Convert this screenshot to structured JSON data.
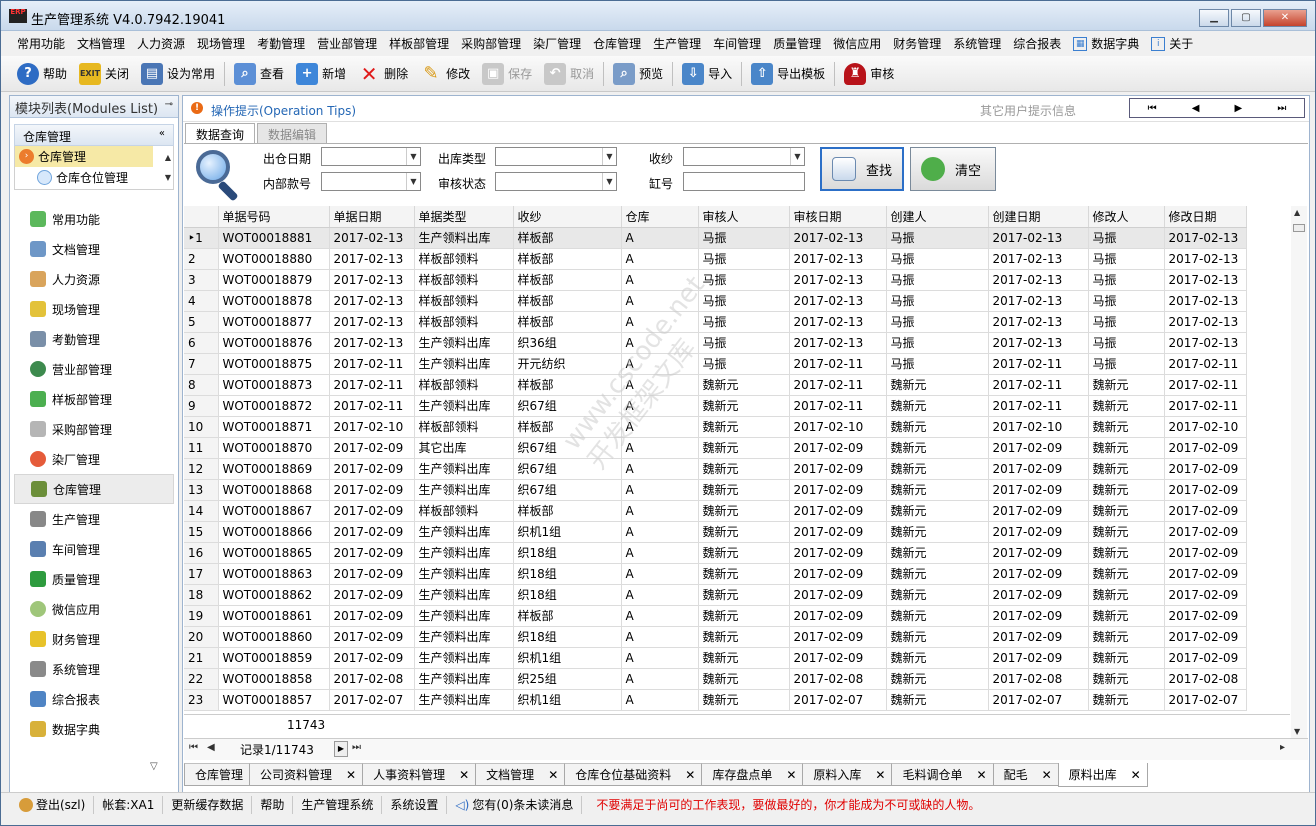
{
  "window": {
    "title": "生产管理系统 V4.0.7942.19041",
    "logo": "ERP"
  },
  "menus": [
    "常用功能",
    "文档管理",
    "人力资源",
    "现场管理",
    "考勤管理",
    "营业部管理",
    "样板部管理",
    "采购部管理",
    "染厂管理",
    "仓库管理",
    "生产管理",
    "车间管理",
    "质量管理",
    "微信应用",
    "财务管理",
    "系统管理",
    "综合报表",
    "数据字典",
    "关于"
  ],
  "toolbar": {
    "help": "帮助",
    "close": "关闭",
    "set_favorite": "设为常用",
    "view": "查看",
    "add": "新增",
    "delete": "删除",
    "edit": "修改",
    "save": "保存",
    "cancel": "取消",
    "preview": "预览",
    "import": "导入",
    "export_template": "导出模板",
    "audit": "审核"
  },
  "sidebar": {
    "header": "模块列表(Modules List)",
    "group": "仓库管理",
    "tree": [
      "仓库管理",
      "仓库仓位管理"
    ],
    "modules": [
      "常用功能",
      "文档管理",
      "人力资源",
      "现场管理",
      "考勤管理",
      "营业部管理",
      "样板部管理",
      "采购部管理",
      "染厂管理",
      "仓库管理",
      "生产管理",
      "车间管理",
      "质量管理",
      "微信应用",
      "财务管理",
      "系统管理",
      "综合报表",
      "数据字典"
    ]
  },
  "tips": {
    "text": "操作提示(Operation Tips)",
    "other": "其它用户提示信息"
  },
  "subtabs": [
    "数据查询",
    "数据编辑"
  ],
  "query": {
    "out_date": "出仓日期",
    "internal_no": "内部款号",
    "out_type": "出库类型",
    "audit_status": "审核状态",
    "receiver": "收纱",
    "vat_no": "缸号",
    "search": "查找",
    "clear": "清空"
  },
  "grid": {
    "columns": [
      "",
      "单据号码",
      "单据日期",
      "单据类型",
      "收纱",
      "仓库",
      "审核人",
      "审核日期",
      "创建人",
      "创建日期",
      "修改人",
      "修改日期"
    ],
    "rows": [
      [
        "1",
        "WOT00018881",
        "2017-02-13",
        "生产领料出库",
        "样板部",
        "A",
        "马振",
        "2017-02-13",
        "马振",
        "2017-02-13",
        "马振",
        "2017-02-13"
      ],
      [
        "2",
        "WOT00018880",
        "2017-02-13",
        "样板部领料",
        "样板部",
        "A",
        "马振",
        "2017-02-13",
        "马振",
        "2017-02-13",
        "马振",
        "2017-02-13"
      ],
      [
        "3",
        "WOT00018879",
        "2017-02-13",
        "样板部领料",
        "样板部",
        "A",
        "马振",
        "2017-02-13",
        "马振",
        "2017-02-13",
        "马振",
        "2017-02-13"
      ],
      [
        "4",
        "WOT00018878",
        "2017-02-13",
        "样板部领料",
        "样板部",
        "A",
        "马振",
        "2017-02-13",
        "马振",
        "2017-02-13",
        "马振",
        "2017-02-13"
      ],
      [
        "5",
        "WOT00018877",
        "2017-02-13",
        "样板部领料",
        "样板部",
        "A",
        "马振",
        "2017-02-13",
        "马振",
        "2017-02-13",
        "马振",
        "2017-02-13"
      ],
      [
        "6",
        "WOT00018876",
        "2017-02-13",
        "生产领料出库",
        "织36组",
        "A",
        "马振",
        "2017-02-13",
        "马振",
        "2017-02-13",
        "马振",
        "2017-02-13"
      ],
      [
        "7",
        "WOT00018875",
        "2017-02-11",
        "生产领料出库",
        "开元纺织",
        "A",
        "马振",
        "2017-02-11",
        "马振",
        "2017-02-11",
        "马振",
        "2017-02-11"
      ],
      [
        "8",
        "WOT00018873",
        "2017-02-11",
        "样板部领料",
        "样板部",
        "A",
        "魏新元",
        "2017-02-11",
        "魏新元",
        "2017-02-11",
        "魏新元",
        "2017-02-11"
      ],
      [
        "9",
        "WOT00018872",
        "2017-02-11",
        "生产领料出库",
        "织67组",
        "A",
        "魏新元",
        "2017-02-11",
        "魏新元",
        "2017-02-11",
        "魏新元",
        "2017-02-11"
      ],
      [
        "10",
        "WOT00018871",
        "2017-02-10",
        "样板部领料",
        "样板部",
        "A",
        "魏新元",
        "2017-02-10",
        "魏新元",
        "2017-02-10",
        "魏新元",
        "2017-02-10"
      ],
      [
        "11",
        "WOT00018870",
        "2017-02-09",
        "其它出库",
        "织67组",
        "A",
        "魏新元",
        "2017-02-09",
        "魏新元",
        "2017-02-09",
        "魏新元",
        "2017-02-09"
      ],
      [
        "12",
        "WOT00018869",
        "2017-02-09",
        "生产领料出库",
        "织67组",
        "A",
        "魏新元",
        "2017-02-09",
        "魏新元",
        "2017-02-09",
        "魏新元",
        "2017-02-09"
      ],
      [
        "13",
        "WOT00018868",
        "2017-02-09",
        "生产领料出库",
        "织67组",
        "A",
        "魏新元",
        "2017-02-09",
        "魏新元",
        "2017-02-09",
        "魏新元",
        "2017-02-09"
      ],
      [
        "14",
        "WOT00018867",
        "2017-02-09",
        "样板部领料",
        "样板部",
        "A",
        "魏新元",
        "2017-02-09",
        "魏新元",
        "2017-02-09",
        "魏新元",
        "2017-02-09"
      ],
      [
        "15",
        "WOT00018866",
        "2017-02-09",
        "生产领料出库",
        "织机1组",
        "A",
        "魏新元",
        "2017-02-09",
        "魏新元",
        "2017-02-09",
        "魏新元",
        "2017-02-09"
      ],
      [
        "16",
        "WOT00018865",
        "2017-02-09",
        "生产领料出库",
        "织18组",
        "A",
        "魏新元",
        "2017-02-09",
        "魏新元",
        "2017-02-09",
        "魏新元",
        "2017-02-09"
      ],
      [
        "17",
        "WOT00018863",
        "2017-02-09",
        "生产领料出库",
        "织18组",
        "A",
        "魏新元",
        "2017-02-09",
        "魏新元",
        "2017-02-09",
        "魏新元",
        "2017-02-09"
      ],
      [
        "18",
        "WOT00018862",
        "2017-02-09",
        "生产领料出库",
        "织18组",
        "A",
        "魏新元",
        "2017-02-09",
        "魏新元",
        "2017-02-09",
        "魏新元",
        "2017-02-09"
      ],
      [
        "19",
        "WOT00018861",
        "2017-02-09",
        "生产领料出库",
        "样板部",
        "A",
        "魏新元",
        "2017-02-09",
        "魏新元",
        "2017-02-09",
        "魏新元",
        "2017-02-09"
      ],
      [
        "20",
        "WOT00018860",
        "2017-02-09",
        "生产领料出库",
        "织18组",
        "A",
        "魏新元",
        "2017-02-09",
        "魏新元",
        "2017-02-09",
        "魏新元",
        "2017-02-09"
      ],
      [
        "21",
        "WOT00018859",
        "2017-02-09",
        "生产领料出库",
        "织机1组",
        "A",
        "魏新元",
        "2017-02-09",
        "魏新元",
        "2017-02-09",
        "魏新元",
        "2017-02-09"
      ],
      [
        "22",
        "WOT00018858",
        "2017-02-08",
        "生产领料出库",
        "织25组",
        "A",
        "魏新元",
        "2017-02-08",
        "魏新元",
        "2017-02-08",
        "魏新元",
        "2017-02-08"
      ],
      [
        "23",
        "WOT00018857",
        "2017-02-07",
        "生产领料出库",
        "织机1组",
        "A",
        "魏新元",
        "2017-02-07",
        "魏新元",
        "2017-02-07",
        "魏新元",
        "2017-02-07"
      ]
    ],
    "total": "11743",
    "record": "记录1/11743"
  },
  "doc_tabs": [
    "仓库管理",
    "公司资料管理",
    "人事资料管理",
    "文档管理",
    "仓库仓位基础资料",
    "库存盘点单",
    "原料入库",
    "毛料调仓单",
    "配毛",
    "原料出库"
  ],
  "status": {
    "login": "登出(szl)",
    "account": "帐套:XA1",
    "refresh_cache": "更新缓存数据",
    "help": "帮助",
    "system": "生产管理系统",
    "settings": "系统设置",
    "messages": "您有(0)条未读消息",
    "motto": "不要满足于尚可的工作表现，要做最好的，你才能成为不可或缺的人物。"
  },
  "watermark": [
    "www.cscode.net",
    "开发框架文库"
  ],
  "colors": {
    "accent": "#2c6fc7",
    "tip": "#2467b5",
    "motto": "#e00000",
    "selected_tree": "#f6e9a6"
  }
}
